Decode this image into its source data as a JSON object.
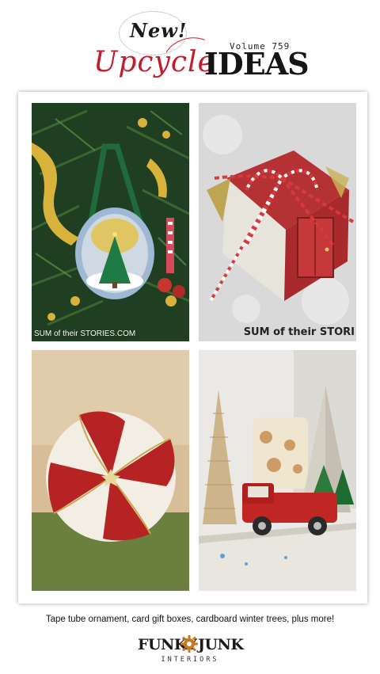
{
  "header": {
    "new_label": "New!",
    "upcycle_label": "Upcycle",
    "ideas_label": "IDEAS",
    "volume_label": "Volume 759"
  },
  "photos": [
    {
      "icon": "tape-tube-ornament-photo",
      "credit": "SUM of their STORIES.COM"
    },
    {
      "icon": "card-gift-box-photo",
      "credit": "SUM of their STORI"
    },
    {
      "icon": "peppermint-ornament-photo"
    },
    {
      "icon": "cardboard-winter-trees-photo"
    }
  ],
  "caption": "Tape tube ornament, card gift boxes, cardboard winter trees, plus more!",
  "logo": {
    "funky": "FUNKY",
    "junk": "JUNK",
    "sub": "INTERIORS"
  },
  "colors": {
    "upcycle_red": "#c21d2e",
    "logo_gear": "#c8781e",
    "ideas_black": "#151515"
  }
}
